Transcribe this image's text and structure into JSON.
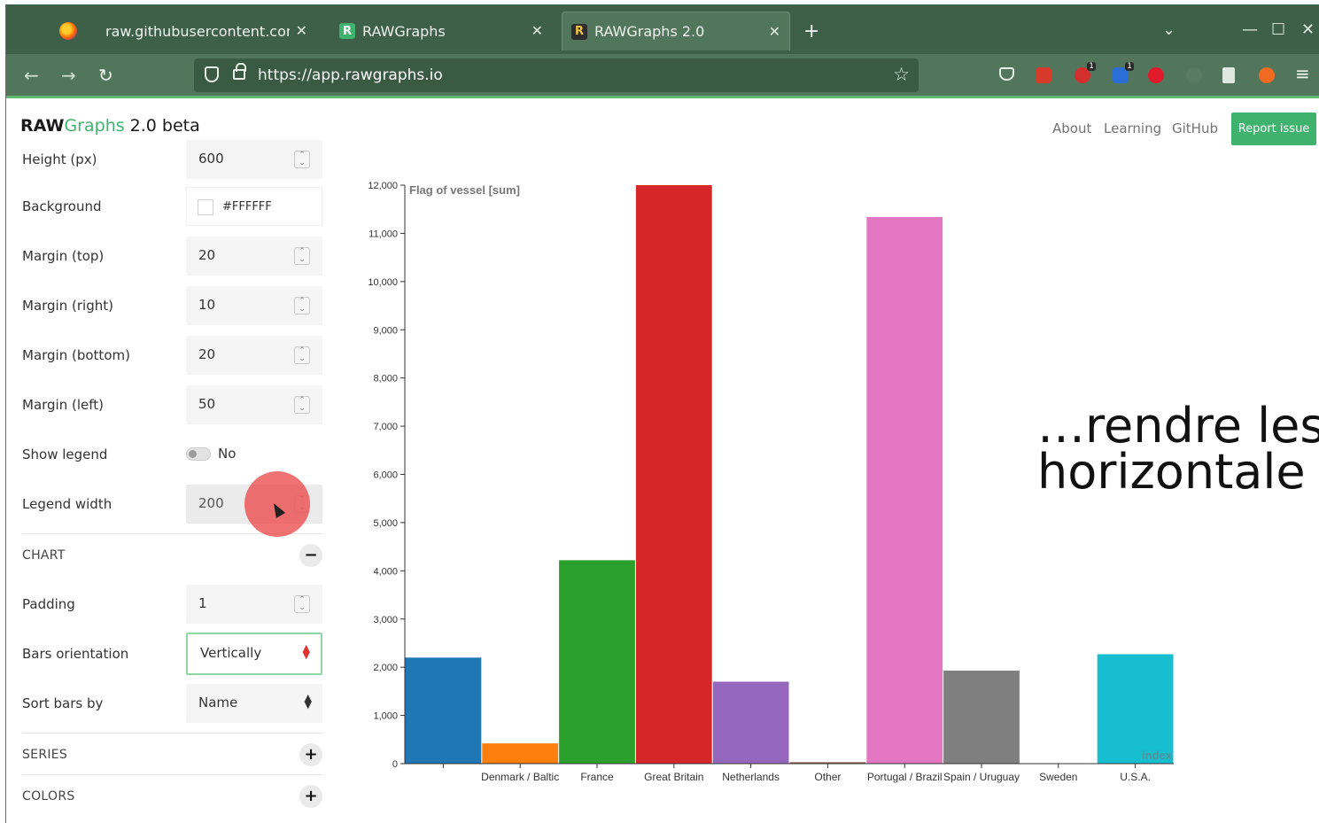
{
  "browser": {
    "tabs": [
      {
        "title": "raw.githubusercontent.com/",
        "icon": "firefox-file-icon",
        "active": false
      },
      {
        "title": "RAWGraphs",
        "icon": "R",
        "active": false
      },
      {
        "title": "RAWGraphs 2.0",
        "icon": "R",
        "active": true
      }
    ],
    "url_prefix": "https://app.",
    "url_domain": "rawgraphs.io",
    "window_controls": [
      "⌄",
      "—",
      "☐",
      "✕"
    ]
  },
  "app": {
    "brand_raw": "RAW",
    "brand_graphs": "Graphs",
    "brand_version": " 2.0 beta",
    "links": [
      "About",
      "Learning",
      "GitHub"
    ],
    "report_button": "Report issue",
    "accent": "#3fb36d"
  },
  "sidebar": {
    "height_label": "Height (px)",
    "height_value": "600",
    "background_label": "Background",
    "background_value": "#FFFFFF",
    "margin_top_label": "Margin (top)",
    "margin_top_value": "20",
    "margin_right_label": "Margin (right)",
    "margin_right_value": "10",
    "margin_bottom_label": "Margin (bottom)",
    "margin_bottom_value": "20",
    "margin_left_label": "Margin (left)",
    "margin_left_value": "50",
    "show_legend_label": "Show legend",
    "show_legend_value": "No",
    "legend_width_label": "Legend width",
    "legend_width_value": "200",
    "chart_section": "CHART",
    "chart_section_icon": "−",
    "padding_label": "Padding",
    "padding_value": "1",
    "orientation_label": "Bars orientation",
    "orientation_value": "Vertically",
    "sort_label": "Sort bars by",
    "sort_value": "Name",
    "series_section": "SERIES",
    "series_section_icon": "+",
    "colors_section": "COLORS",
    "colors_section_icon": "+"
  },
  "overlay": {
    "line1": "…rendre les",
    "line2": "horizontale"
  },
  "chart_data": {
    "type": "bar",
    "title": "",
    "ylabel": "Flag of vessel [sum]",
    "xlabel": "index",
    "ylim": [
      0,
      12000
    ],
    "yticks": [
      0,
      1000,
      2000,
      3000,
      4000,
      5000,
      6000,
      7000,
      8000,
      9000,
      10000,
      11000,
      12000
    ],
    "ytick_labels": [
      "0",
      "1,000",
      "2,000",
      "3,000",
      "4,000",
      "5,000",
      "6,000",
      "7,000",
      "8,000",
      "9,000",
      "10,000",
      "11,000",
      "12,000"
    ],
    "categories": [
      "",
      "Denmark / Baltic",
      "France",
      "Great Britain",
      "Netherlands",
      "Other",
      "Portugal / Brazil",
      "Spain / Uruguay",
      "Sweden",
      "U.S.A."
    ],
    "values": [
      2200,
      420,
      4220,
      12000,
      1700,
      30,
      11340,
      1930,
      0,
      2270
    ],
    "colors": [
      "#1f77b4",
      "#ff7f0e",
      "#2ca02c",
      "#d62728",
      "#9467bd",
      "#8c564b",
      "#e377c2",
      "#7f7f7f",
      "#bcbd22",
      "#17becf"
    ],
    "grid": false,
    "legend": "none"
  }
}
